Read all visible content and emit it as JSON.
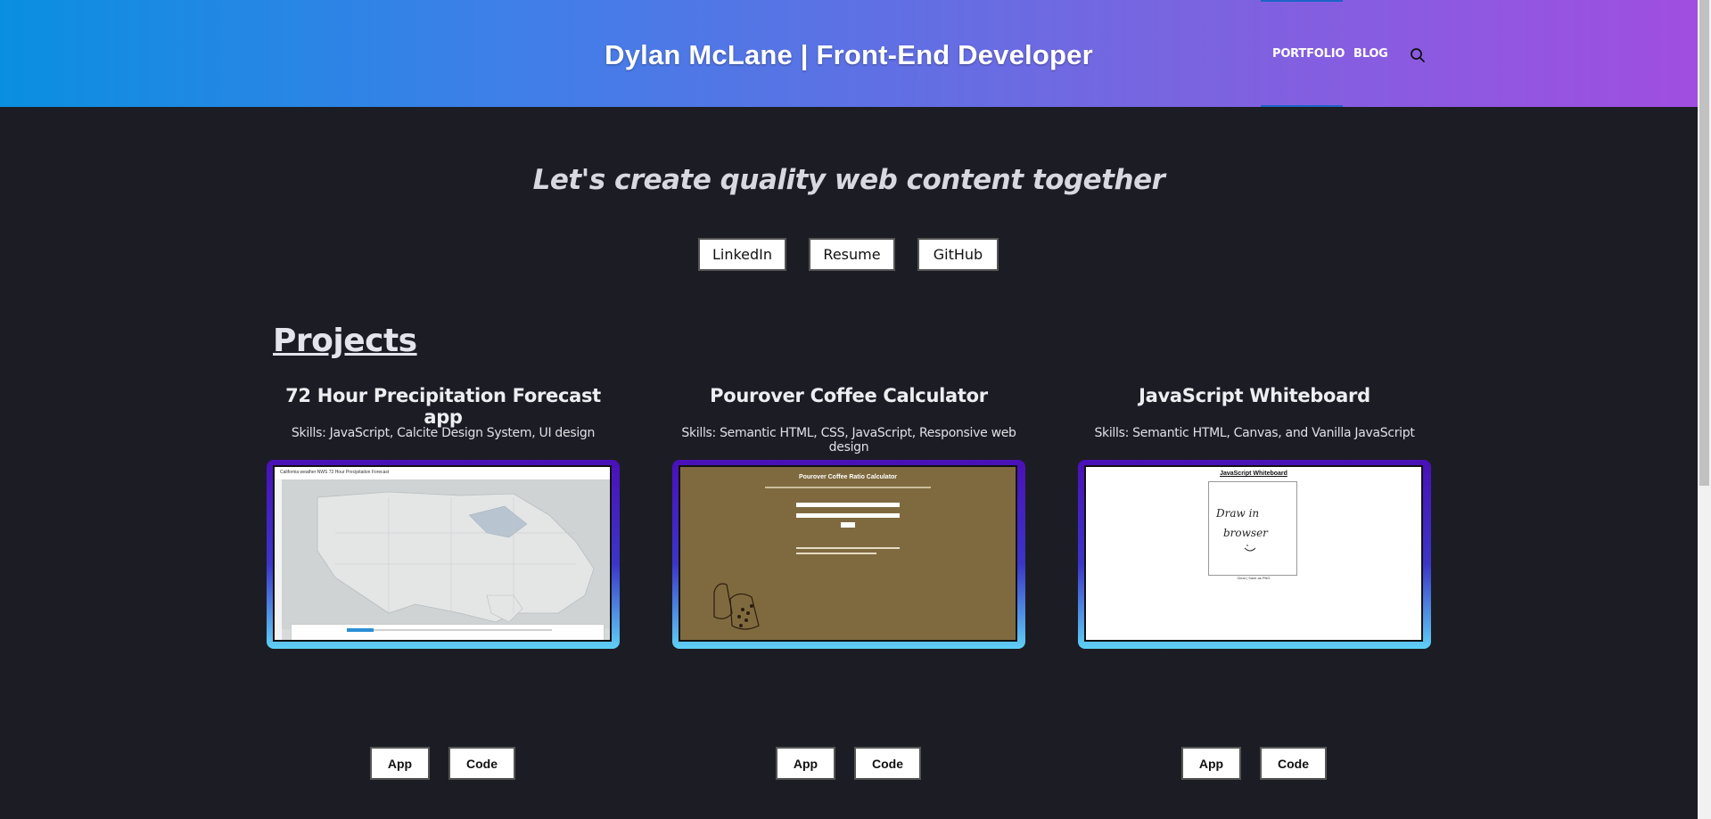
{
  "header": {
    "site_title": "Dylan McLane | Front-End Developer",
    "nav": {
      "portfolio": "PORTFOLIO",
      "blog": "BLOG"
    },
    "search_icon": "search-icon"
  },
  "hero": {
    "tagline": "Let's create quality web content together",
    "buttons": {
      "linkedin": "LinkedIn",
      "resume": "Resume",
      "github": "GitHub"
    }
  },
  "projects": {
    "heading": "Projects",
    "items": [
      {
        "title": "72 Hour Precipitation Forecast app",
        "skills": "Skills: JavaScript, Calcite Design System, UI design",
        "app_label": "App",
        "code_label": "Code",
        "thumb": {
          "header_text": "California weather NWS 72 Hour Precipitation Forecast"
        }
      },
      {
        "title": "Pourover Coffee Calculator",
        "skills": "Skills: Semantic HTML, CSS, JavaScript, Responsive web design",
        "app_label": "App",
        "code_label": "Code",
        "thumb": {
          "header_text": "Pourover Coffee Ratio Calculator"
        }
      },
      {
        "title": "JavaScript Whiteboard",
        "skills": "Skills: Semantic HTML, Canvas, and Vanilla JavaScript",
        "app_label": "App",
        "code_label": "Code",
        "thumb": {
          "header_text": "JavaScript Whiteboard",
          "canvas_text_1": "Draw in",
          "canvas_text_2": "browser",
          "button_text": "Clear | Save as PNG"
        }
      }
    ]
  },
  "colors": {
    "background": "#1c1d24",
    "header_gradient_start": "#0a8fe0",
    "header_gradient_end": "#a04ee0",
    "thumb_border_top": "#4a10b8",
    "thumb_border_bottom": "#5fd0f5",
    "coffee_bg": "#7f6a3f"
  }
}
